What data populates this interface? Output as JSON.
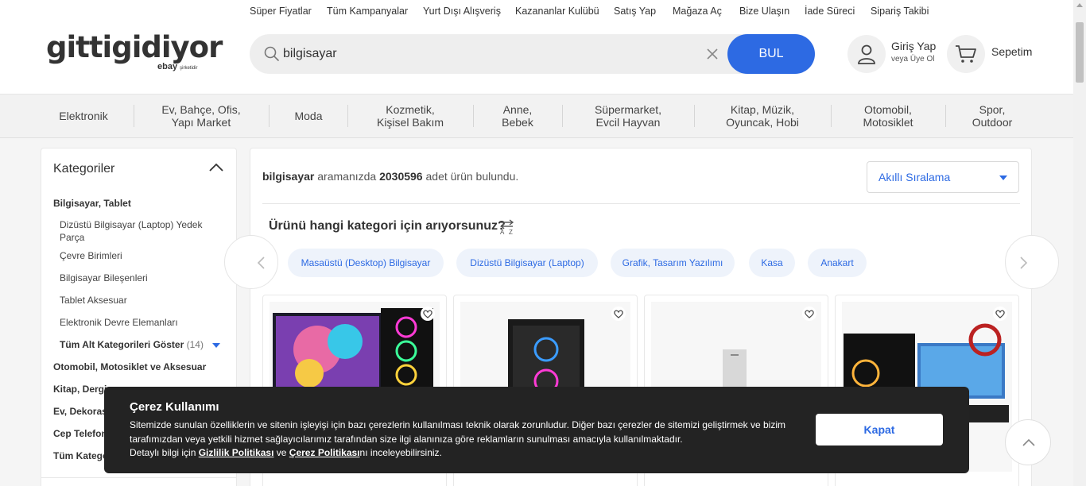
{
  "top_links": [
    "Süper Fiyatlar",
    "Tüm Kampanyalar",
    "Yurt Dışı Alışveriş",
    "Kazananlar Kulübü",
    "Satış Yap",
    "Mağaza Aç",
    "Bize Ulaşın",
    "İade Süreci",
    "Sipariş Takibi"
  ],
  "header": {
    "logo": "gittigidiyor",
    "logo_sub_brand": "ebay",
    "logo_sub_text": "şirketidir",
    "search_value": "bilgisayar",
    "search_button": "BUL",
    "login_label": "Giriş Yap",
    "register_label": "veya Üye Ol",
    "cart_label": "Sepetim"
  },
  "categories_nav": [
    {
      "line1": "Elektronik",
      "line2": ""
    },
    {
      "line1": "Ev, Bahçe, Ofis,",
      "line2": "Yapı Market"
    },
    {
      "line1": "Moda",
      "line2": ""
    },
    {
      "line1": "Kozmetik,",
      "line2": "Kişisel Bakım"
    },
    {
      "line1": "Anne,",
      "line2": "Bebek"
    },
    {
      "line1": "Süpermarket,",
      "line2": "Evcil Hayvan"
    },
    {
      "line1": "Kitap, Müzik,",
      "line2": "Oyuncak, Hobi"
    },
    {
      "line1": "Otomobil,",
      "line2": "Motosiklet"
    },
    {
      "line1": "Spor,",
      "line2": "Outdoor"
    }
  ],
  "sidebar": {
    "title": "Kategoriler",
    "items": [
      {
        "label": "Bilgisayar, Tablet",
        "level": 0
      },
      {
        "label": "Dizüstü Bilgisayar (Laptop) Yedek Parça",
        "level": 1
      },
      {
        "label": "Çevre Birimleri",
        "level": 1
      },
      {
        "label": "Bilgisayar Bileşenleri",
        "level": 1
      },
      {
        "label": "Tablet Aksesuar",
        "level": 1
      },
      {
        "label": "Elektronik Devre Elemanları",
        "level": 1
      },
      {
        "label": "Tüm Alt Kategorileri Göster",
        "level": 1,
        "count": "(14)"
      },
      {
        "label": "Otomobil, Motosiklet ve Aksesuar",
        "level": 0
      },
      {
        "label": "Kitap, Dergi",
        "level": 0
      },
      {
        "label": "Ev, Dekorasyon",
        "level": 0
      },
      {
        "label": "Cep Telefonu",
        "level": 0
      },
      {
        "label": "Tüm Kategoriler",
        "level": 0
      }
    ]
  },
  "results": {
    "query": "bilgisayar",
    "text_mid": "aramanızda",
    "count": "2030596",
    "text_end": "adet ürün bulundu."
  },
  "sort": {
    "selected": "Akıllı Sıralama"
  },
  "category_question": "Ürünü hangi kategori için arıyorsunuz?",
  "sort_az": {
    "top": "A",
    "bottom": "Z"
  },
  "category_chips": [
    "Masaüstü (Desktop) Bilgisayar",
    "Dizüstü Bilgisayar (Laptop)",
    "Grafik, Tasarım Yazılımı",
    "Kasa",
    "Anakart"
  ],
  "cookie": {
    "title": "Çerez Kullanımı",
    "line1": "Sitemizde sunulan özelliklerin ve sitenin işleyişi için bazı çerezlerin kullanılması teknik olarak zorunludur. Diğer bazı çerezler de sitemizi geliştirmek ve bizim",
    "line2": "tarafımızdan veya yetkili hizmet sağlayıcılarımız tarafından size ilgi alanınıza göre reklamların sunulması amacıyla kullanılmaktadır.",
    "line3_a": "Detaylı bilgi için",
    "link1": "Gizlilik Politikası",
    "line3_b": "ve",
    "link2": "Çerez Politikası",
    "line3_c": "nı inceleyebilirsiniz.",
    "button": "Kapat"
  },
  "colors": {
    "accent": "#2d6ae3",
    "chip_bg": "#eef3fb",
    "cookie_bg": "#232323"
  }
}
